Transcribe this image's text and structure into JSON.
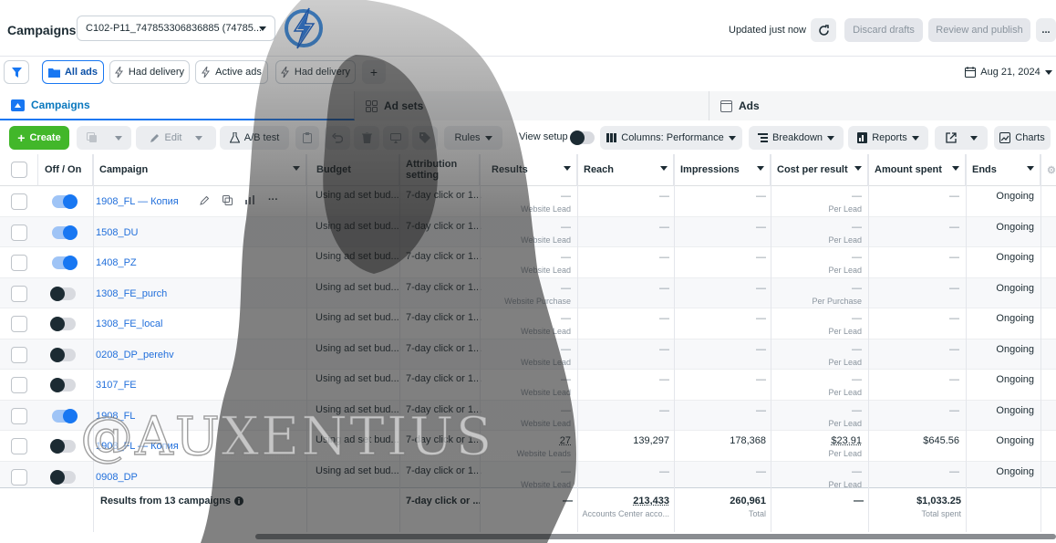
{
  "header": {
    "title": "Campaigns",
    "account_select": "C102-P11_747853306836885 (74785...",
    "updated_text": "Updated just now",
    "discard_label": "Discard drafts",
    "review_label": "Review and publish",
    "more_label": "..."
  },
  "filters": {
    "all_ads": "All ads",
    "had_delivery": "Had delivery",
    "active_ads": "Active ads",
    "had_delivery_2": "Had delivery",
    "add_label": "+",
    "date": "Aug 21, 2024"
  },
  "tabs": [
    {
      "label": "Campaigns"
    },
    {
      "label": "Ad sets"
    },
    {
      "label": "Ads"
    }
  ],
  "toolbar": {
    "create": "Create",
    "edit": "Edit",
    "ab_test": "A/B test",
    "rules": "Rules",
    "view_setup": "View setup",
    "columns": "Columns: Performance",
    "breakdown": "Breakdown",
    "reports": "Reports",
    "charts": "Charts"
  },
  "table": {
    "columns": {
      "off_on": "Off / On",
      "campaign": "Campaign",
      "budget": "Budget",
      "attribution": "Attribution setting",
      "results": "Results",
      "reach": "Reach",
      "impressions": "Impressions",
      "cpr": "Cost per result",
      "amount": "Amount spent",
      "ends": "Ends"
    },
    "rows": [
      {
        "on": true,
        "name": "1908_FL — Копия",
        "budget": "Using ad set bud...",
        "attribution": "7-day click or 1...",
        "results": "—",
        "results_sub": "Website Lead",
        "reach": "—",
        "impressions": "—",
        "cpr": "—",
        "cpr_sub": "Per Lead",
        "amount": "—",
        "ends": "Ongoing"
      },
      {
        "on": true,
        "name": "1508_DU",
        "budget": "Using ad set bud...",
        "attribution": "7-day click or 1...",
        "results": "—",
        "results_sub": "Website Lead",
        "reach": "—",
        "impressions": "—",
        "cpr": "—",
        "cpr_sub": "Per Lead",
        "amount": "—",
        "ends": "Ongoing"
      },
      {
        "on": true,
        "name": "1408_PZ",
        "budget": "Using ad set bud...",
        "attribution": "7-day click or 1...",
        "results": "—",
        "results_sub": "Website Lead",
        "reach": "—",
        "impressions": "—",
        "cpr": "—",
        "cpr_sub": "Per Lead",
        "amount": "—",
        "ends": "Ongoing"
      },
      {
        "on": false,
        "name": "1308_FE_purch",
        "budget": "Using ad set bud...",
        "attribution": "7-day click or 1...",
        "results": "—",
        "results_sub": "Website Purchase",
        "reach": "—",
        "impressions": "—",
        "cpr": "—",
        "cpr_sub": "Per Purchase",
        "amount": "—",
        "ends": "Ongoing"
      },
      {
        "on": false,
        "name": "1308_FE_local",
        "budget": "Using ad set bud...",
        "attribution": "7-day click or 1...",
        "results": "—",
        "results_sub": "Website Lead",
        "reach": "—",
        "impressions": "—",
        "cpr": "—",
        "cpr_sub": "Per Lead",
        "amount": "—",
        "ends": "Ongoing"
      },
      {
        "on": false,
        "name": "0208_DP_perehv",
        "budget": "Using ad set bud...",
        "attribution": "7-day click or 1...",
        "results": "—",
        "results_sub": "Website Lead",
        "reach": "—",
        "impressions": "—",
        "cpr": "—",
        "cpr_sub": "Per Lead",
        "amount": "—",
        "ends": "Ongoing"
      },
      {
        "on": false,
        "name": "3107_FE",
        "budget": "Using ad set bud...",
        "attribution": "7-day click or 1...",
        "results": "—",
        "results_sub": "Website Lead",
        "reach": "—",
        "impressions": "—",
        "cpr": "—",
        "cpr_sub": "Per Lead",
        "amount": "—",
        "ends": "Ongoing"
      },
      {
        "on": true,
        "name": "1908_FL",
        "budget": "Using ad set bud...",
        "attribution": "7-day click or 1...",
        "results": "—",
        "results_sub": "Website Lead",
        "reach": "—",
        "impressions": "—",
        "cpr": "—",
        "cpr_sub": "Per Lead",
        "amount": "—",
        "ends": "Ongoing"
      },
      {
        "on": false,
        "name": "1908_FL — Копия",
        "budget": "Using ad set bud...",
        "attribution": "7-day click or 1...",
        "results": "27",
        "results_sub": "Website Leads",
        "reach": "139,297",
        "impressions": "178,368",
        "cpr": "$23.91",
        "cpr_sub": "Per Lead",
        "amount": "$645.56",
        "ends": "Ongoing"
      },
      {
        "on": false,
        "name": "0908_DP",
        "budget": "Using ad set bud...",
        "attribution": "7-day click or 1...",
        "results": "—",
        "results_sub": "Website Lead",
        "reach": "—",
        "impressions": "—",
        "cpr": "—",
        "cpr_sub": "Per Lead",
        "amount": "—",
        "ends": "Ongoing"
      }
    ],
    "footer": {
      "label": "Results from 13 campaigns",
      "attribution": "7-day click or ...",
      "results": "—",
      "reach": "213,433",
      "reach_sub": "Accounts Center acco...",
      "impressions": "260,961",
      "impressions_sub": "Total",
      "cpr": "—",
      "amount": "$1,033.25",
      "amount_sub": "Total spent"
    }
  },
  "watermark": "@AUXENTIUS",
  "colors": {
    "accent": "#1877f2",
    "create": "#42b72a",
    "link": "#216fdb"
  }
}
